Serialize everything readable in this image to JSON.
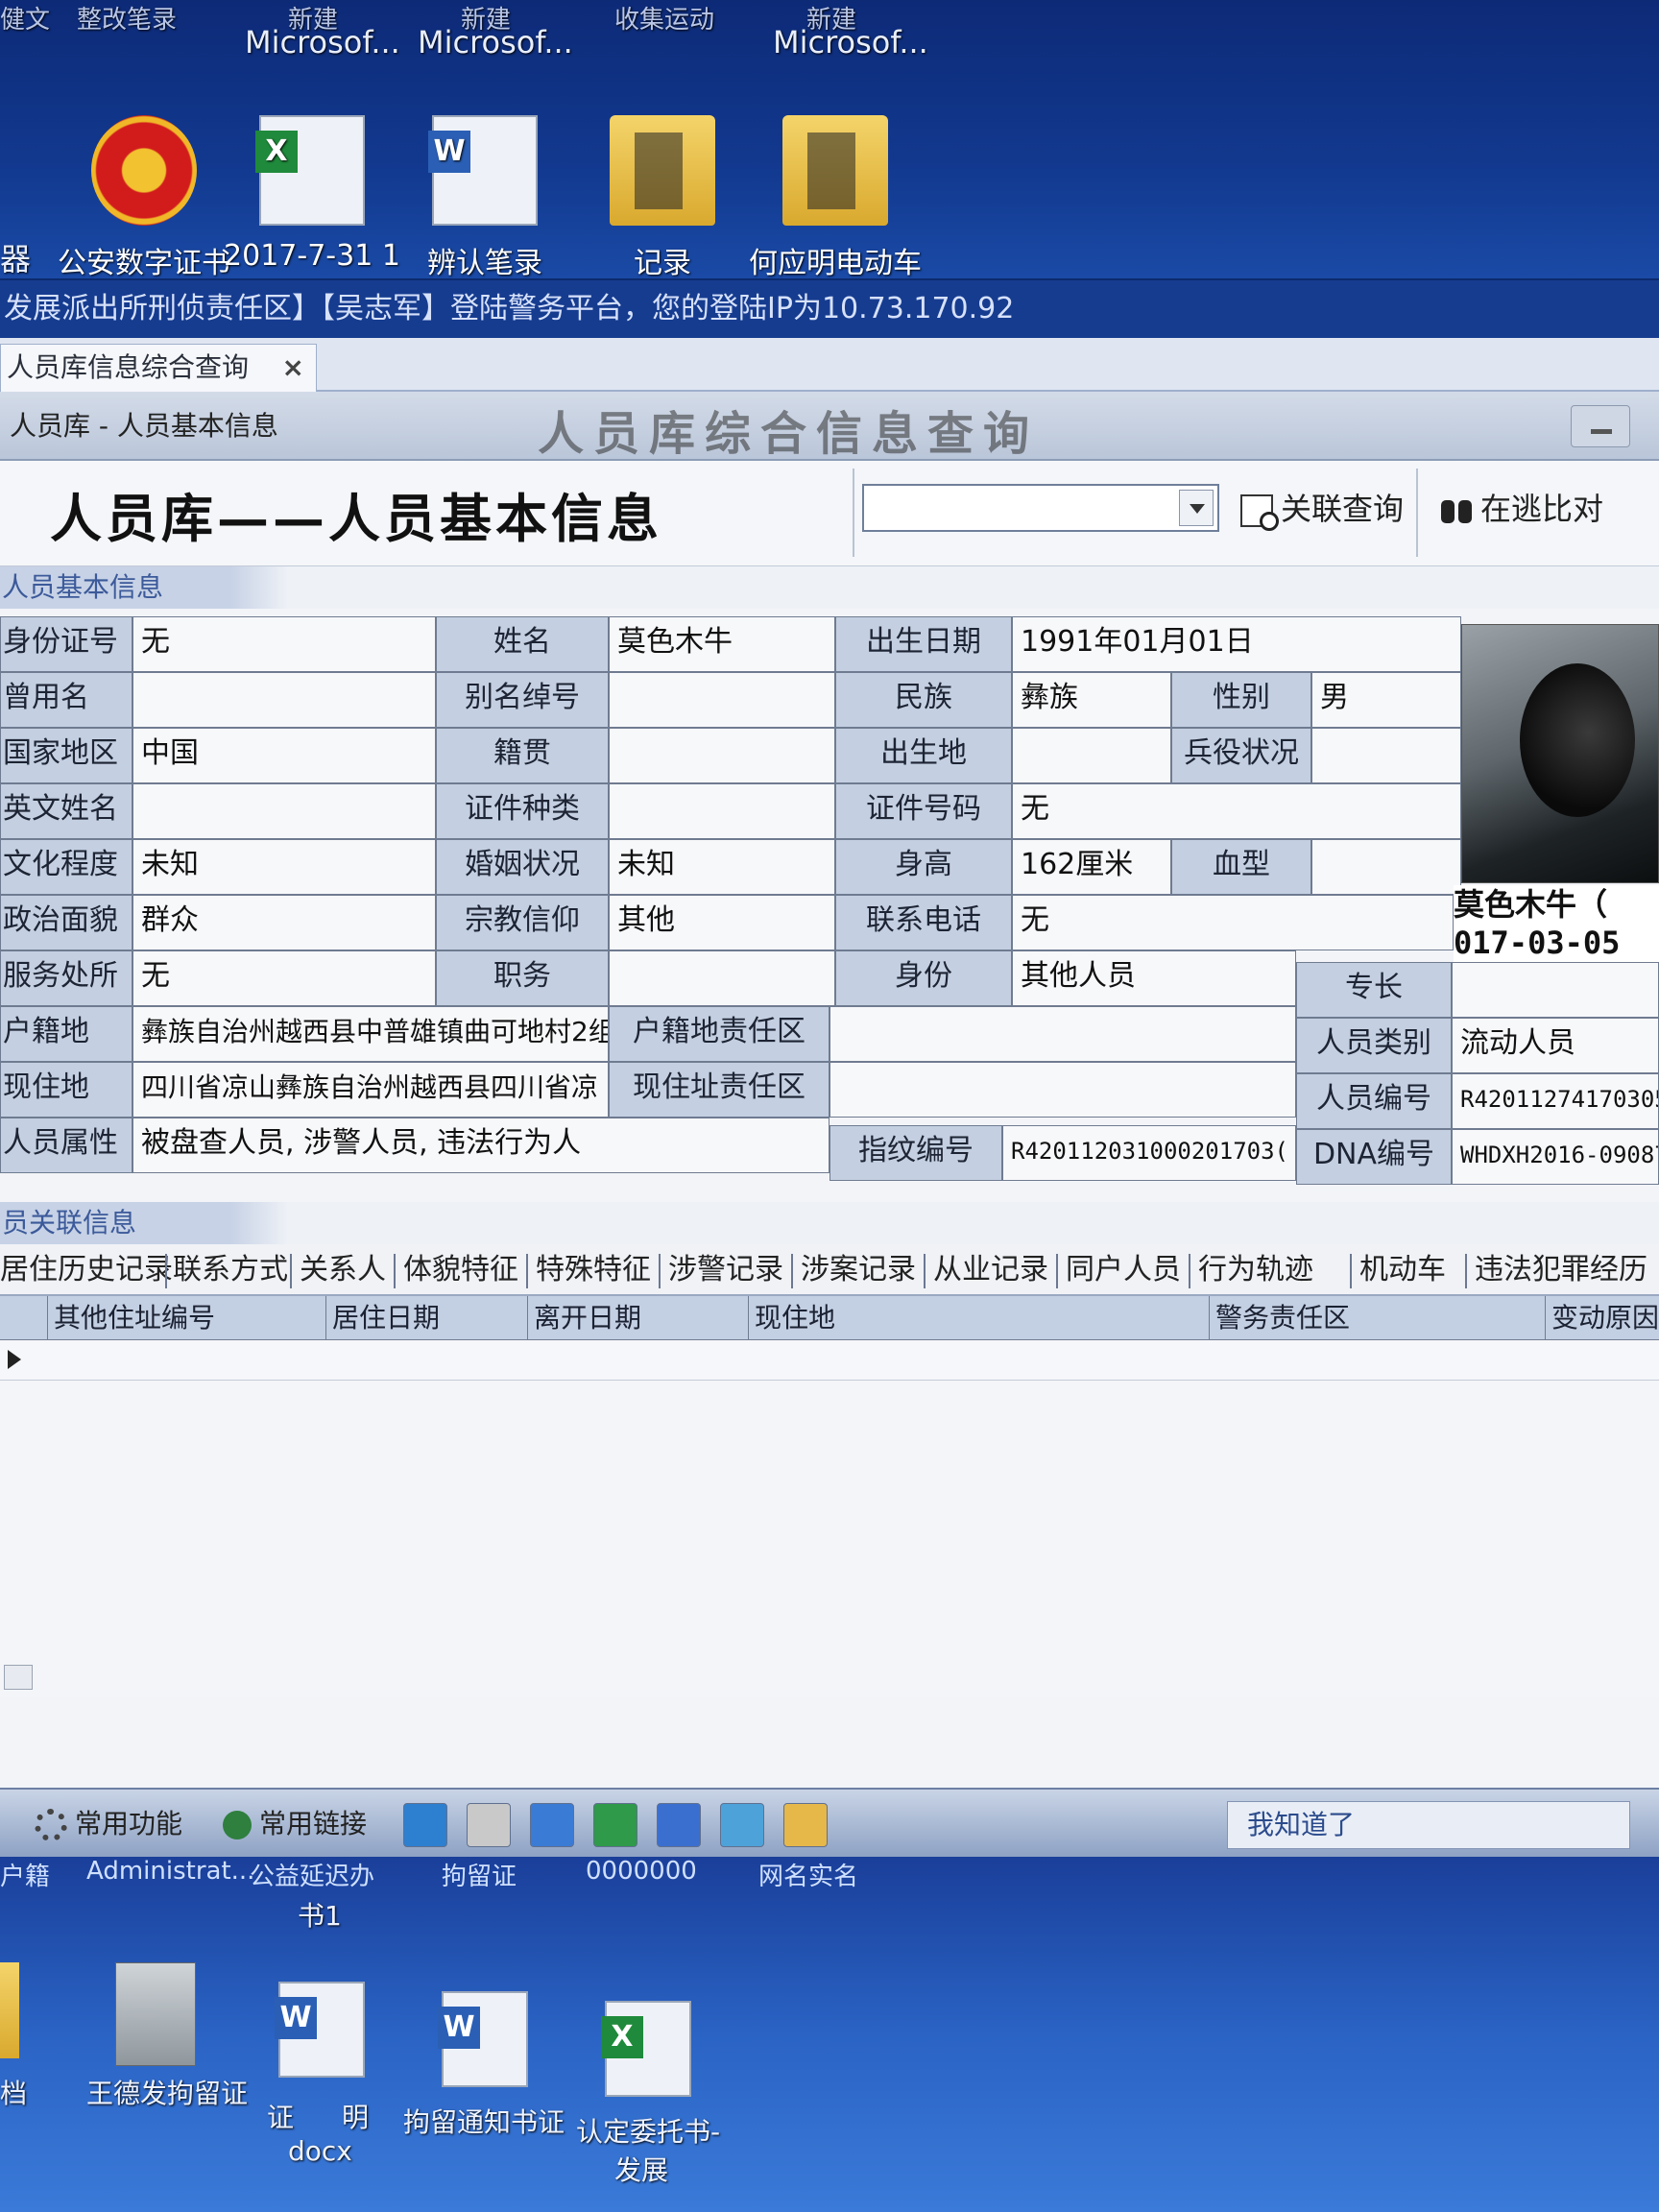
{
  "desktop_top": {
    "faded_labels": [
      "健文",
      "整改笔录",
      "新建",
      "新建",
      "收集运动",
      "新建"
    ],
    "labels": [
      "Microsof...",
      "Microsof...",
      "Microsof..."
    ],
    "icons": [
      {
        "label": "公安数字证书",
        "icon": "police-emblem-icon"
      },
      {
        "label": "2017-7-31 1",
        "icon": "excel-doc-icon"
      },
      {
        "label": "辨认笔录",
        "icon": "word-doc-icon"
      },
      {
        "label": "记录",
        "icon": "folder-icon"
      },
      {
        "label": "何应明电动车",
        "icon": "folder-icon"
      }
    ],
    "left_fragment": "器"
  },
  "status_bar": {
    "text": "发展派出所刑侦责任区】【吴志军】登陆警务平台，您的登陆IP为10.73.170.92"
  },
  "app": {
    "tab_label": "人员库信息综合查询",
    "tab_close": "×",
    "breadcrumb": "人员库 - 人员基本信息",
    "header_blur_title": "人员库综合信息查询",
    "page_title": "人员库——人员基本信息",
    "combo_value": "",
    "btn_related_query": "关联查询",
    "btn_fugitive_compare": "在逃比对",
    "section_basic": "人员基本信息",
    "section_related": "员关联信息"
  },
  "person": {
    "id_label": "身份证号",
    "id_value": "无",
    "name_label": "姓名",
    "name_value": "莫色木牛",
    "birth_label": "出生日期",
    "birth_value": "1991年01月01日",
    "alias_label": "曾用名",
    "alias_value": "",
    "alias_no_label": "别名绰号",
    "alias_no_value": "",
    "ethnic_label": "民族",
    "ethnic_value": "彝族",
    "gender_label": "性别",
    "gender_value": "男",
    "country_label": "国家地区",
    "country_value": "中国",
    "native_label": "籍贯",
    "native_value": "",
    "birthplace_label": "出生地",
    "birthplace_value": "",
    "military_label": "兵役状况",
    "military_value": "",
    "english_label": "英文姓名",
    "english_value": "",
    "cert_type_label": "证件种类",
    "cert_type_value": "",
    "cert_no_label": "证件号码",
    "cert_no_value": "无",
    "edu_label": "文化程度",
    "edu_value": "未知",
    "marital_label": "婚姻状况",
    "marital_value": "未知",
    "height_label": "身高",
    "height_value": "162厘米",
    "blood_label": "血型",
    "blood_value": "",
    "political_label": "政治面貌",
    "political_value": "群众",
    "religion_label": "宗教信仰",
    "religion_value": "其他",
    "phone_label": "联系电话",
    "phone_value": "无",
    "workplace_label": "服务处所",
    "workplace_value": "无",
    "job_label": "职务",
    "job_value": "",
    "identity_label": "身份",
    "identity_value": "其他人员",
    "specialty_label": "专长",
    "specialty_value": "",
    "hukou_label": "户籍地",
    "hukou_value": "彝族自治州越西县中普雄镇曲可地村2组",
    "hukou_zone_label": "户籍地责任区",
    "hukou_zone_value": "",
    "category_label": "人员类别",
    "category_value": "流动人员",
    "residence_label": "现住地",
    "residence_value": "四川省凉山彝族自治州越西县四川省凉",
    "residence_zone_label": "现住址责任区",
    "residence_zone_value": "",
    "person_no_label": "人员编号",
    "person_no_value": "R42011274170305",
    "attr_label": "人员属性",
    "attr_value": "被盘查人员, 涉警人员, 违法行为人",
    "finger_label": "指纹编号",
    "finger_value": "R420112031000201703(",
    "dna_label": "DNA编号",
    "dna_value": "WHDXH2016-09087",
    "photo_caption_1": "莫色木牛（",
    "photo_caption_2": "017-03-05"
  },
  "related": {
    "tabs": [
      "居住历史记录",
      "联系方式",
      "关系人",
      "体貌特征",
      "特殊特征",
      "涉警记录",
      "涉案记录",
      "从业记录",
      "同户人员",
      "行为轨迹",
      "机动车",
      "违法犯罪经历"
    ],
    "columns": [
      "其他住址编号",
      "居住日期",
      "离开日期",
      "现住地",
      "警务责任区",
      "变动原因"
    ]
  },
  "taskbar": {
    "common_functions": "常用功能",
    "common_links": "常用链接",
    "know_it": "我知道了"
  },
  "desktop_bottom": {
    "cut_labels": [
      "户籍",
      "Administrat...",
      "公益延迟办",
      "拘留证",
      "0000000",
      "网名实名"
    ],
    "labels": [
      "书1",
      "王德发拘留证",
      "证",
      "明",
      "拘留通知书证",
      "认定委托书-",
      "发展",
      "docx",
      "档"
    ]
  }
}
